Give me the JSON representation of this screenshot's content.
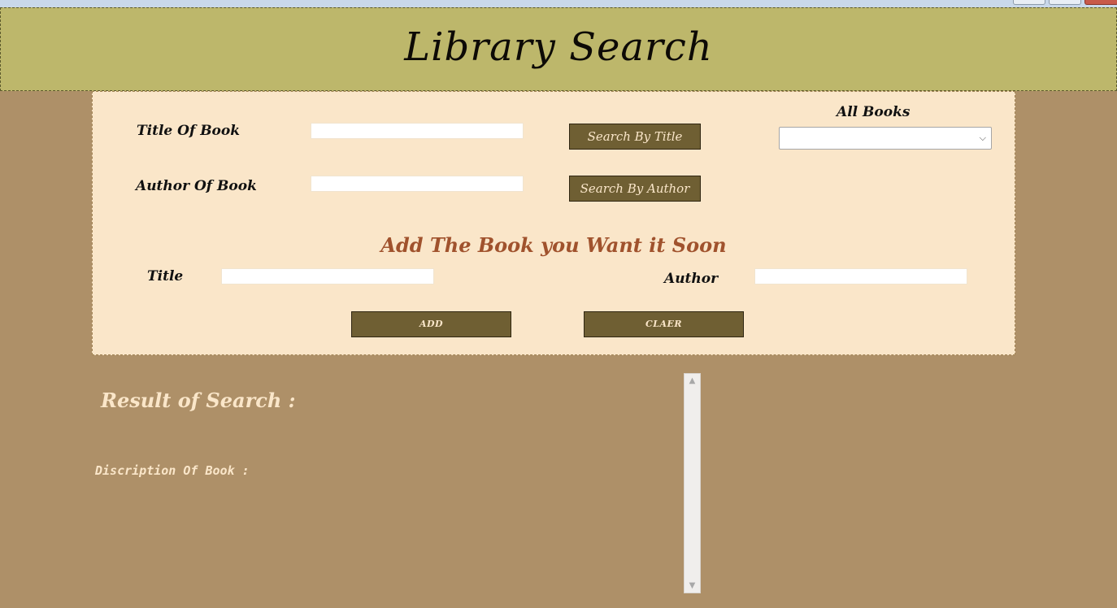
{
  "header": {
    "title": "Library Search"
  },
  "search": {
    "title_label": "Title Of Book",
    "title_value": "",
    "author_label": "Author Of Book",
    "author_value": "",
    "search_title_button": "Search By Title",
    "search_author_button": "Search By Author",
    "all_books_label": "All Books",
    "all_books_selected": "",
    "all_books_chevron": "⌵"
  },
  "add_book": {
    "heading": "Add The Book you Want it Soon",
    "title_label": "Title",
    "title_value": "",
    "author_label": "Author",
    "author_value": "",
    "add_button": "ADD",
    "clear_button": "CLAER"
  },
  "results": {
    "heading": "Result of Search :",
    "description_label": "Discription Of Book :",
    "scroll_up_glyph": "▲",
    "scroll_down_glyph": "▼"
  },
  "colors": {
    "background": "#ae9068",
    "header": "#bdb76b",
    "panel": "#fae6c9",
    "button": "#6f5f33",
    "heading_accent": "#a0522d"
  }
}
